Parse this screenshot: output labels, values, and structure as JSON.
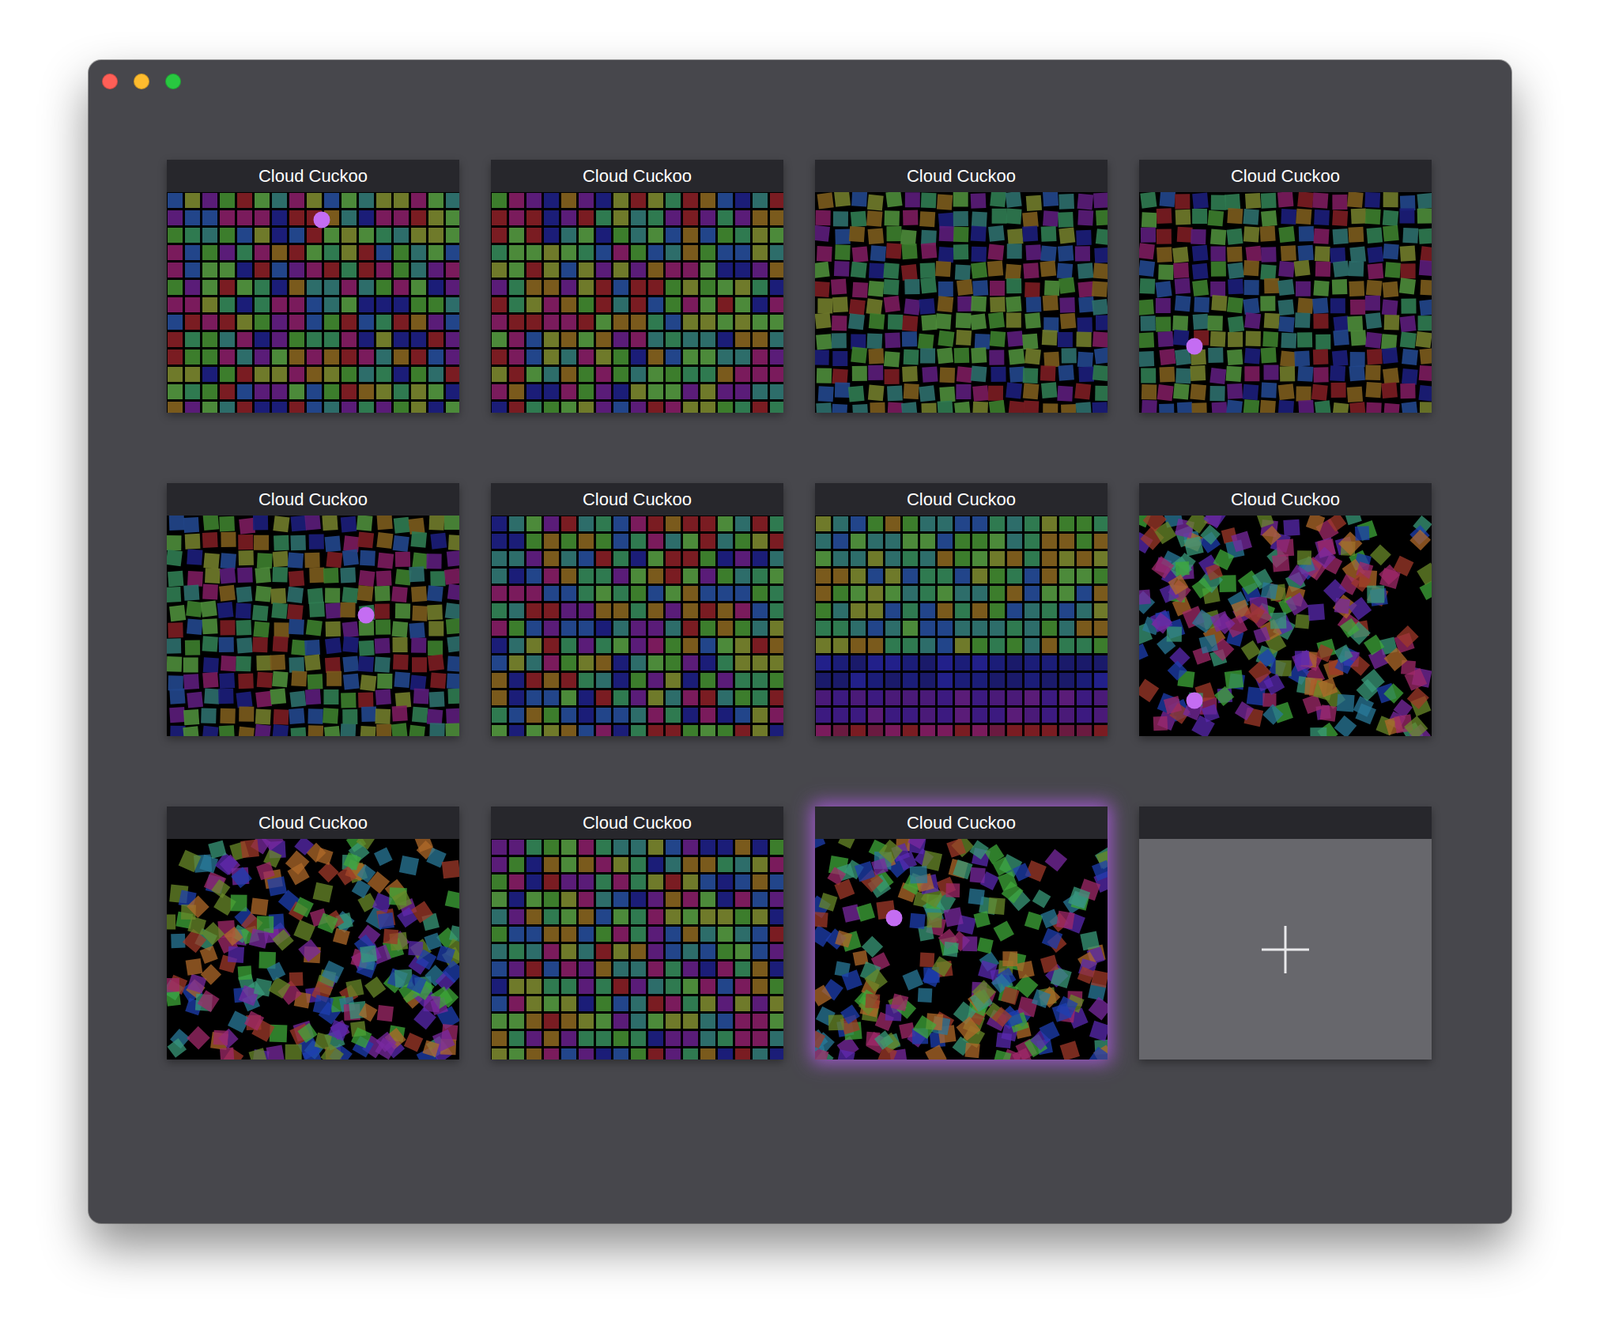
{
  "traffic_lights": [
    {
      "color": "#ff5f57"
    },
    {
      "color": "#febc2e"
    },
    {
      "color": "#28c840"
    }
  ],
  "tiles": [
    {
      "kind": "pattern",
      "title": "Cloud Cuckoo",
      "pattern": "grid",
      "dot": [
        0.53,
        0.125
      ],
      "selected": false
    },
    {
      "kind": "pattern",
      "title": "Cloud Cuckoo",
      "pattern": "grid",
      "dot": null,
      "selected": false
    },
    {
      "kind": "pattern",
      "title": "Cloud Cuckoo",
      "pattern": "jitter",
      "dot": null,
      "selected": false
    },
    {
      "kind": "pattern",
      "title": "Cloud Cuckoo",
      "pattern": "jitter",
      "dot": [
        0.19,
        0.7
      ],
      "selected": false
    },
    {
      "kind": "pattern",
      "title": "Cloud Cuckoo",
      "pattern": "jitter",
      "dot": [
        0.68,
        0.45
      ],
      "selected": false
    },
    {
      "kind": "pattern",
      "title": "Cloud Cuckoo",
      "pattern": "grid",
      "dot": null,
      "selected": false
    },
    {
      "kind": "pattern",
      "title": "Cloud Cuckoo",
      "pattern": "bands",
      "dot": null,
      "selected": false
    },
    {
      "kind": "pattern",
      "title": "Cloud Cuckoo",
      "pattern": "scatter",
      "dot": [
        0.19,
        0.84
      ],
      "selected": false
    },
    {
      "kind": "pattern",
      "title": "Cloud Cuckoo",
      "pattern": "scatter",
      "dot": null,
      "selected": false
    },
    {
      "kind": "pattern",
      "title": "Cloud Cuckoo",
      "pattern": "grid",
      "dot": null,
      "selected": false
    },
    {
      "kind": "pattern",
      "title": "Cloud Cuckoo",
      "pattern": "scatter",
      "dot": [
        0.27,
        0.36
      ],
      "selected": true
    },
    {
      "kind": "add",
      "selected": false
    }
  ]
}
